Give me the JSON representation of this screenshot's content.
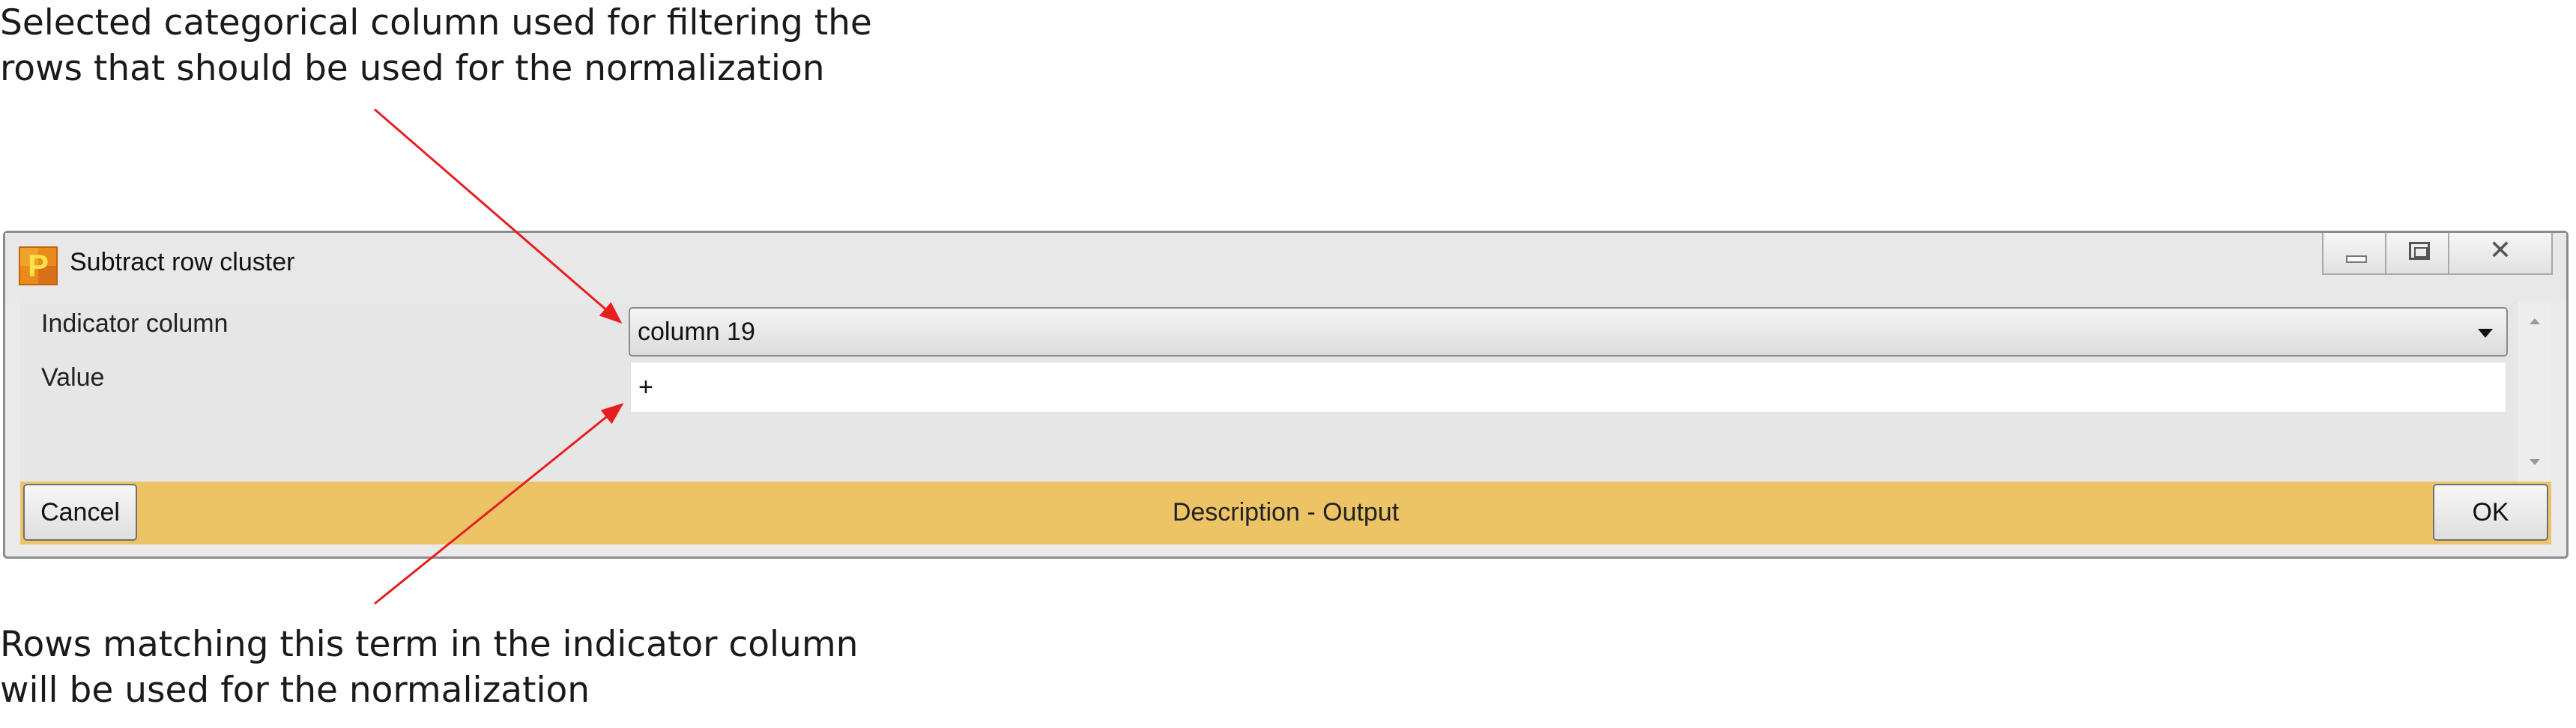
{
  "annotations": {
    "top": {
      "line1": "Selected categorical column used for filtering the",
      "line2": "rows that should be used for the normalization"
    },
    "bottom": {
      "line1": "Rows matching this term in the indicator column",
      "line2": "will be used for the normalization"
    }
  },
  "window": {
    "title": "Subtract row cluster",
    "icon": "perseus-app-icon",
    "caption_buttons": [
      "minimize-icon",
      "maximize-icon",
      "close-icon"
    ]
  },
  "form": {
    "indicator_label": "Indicator column",
    "indicator_value": "column 19",
    "value_label": "Value",
    "value_text": "+"
  },
  "footer": {
    "cancel_label": "Cancel",
    "description": "Description - Output",
    "ok_label": "OK"
  },
  "colors": {
    "arrow": "#e81e1e",
    "footer_band": "#ecc466",
    "window_background": "#eaeaea"
  }
}
